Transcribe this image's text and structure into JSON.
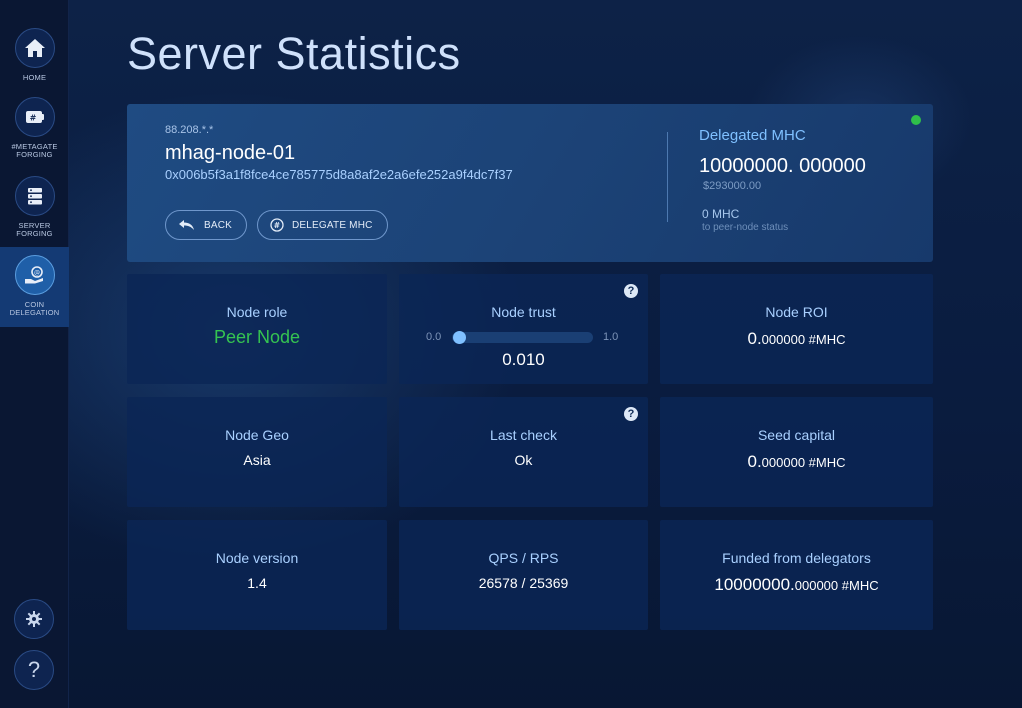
{
  "sidebar": {
    "items": [
      {
        "label": "HOME",
        "icon": "home-icon",
        "active": false
      },
      {
        "label": "#METAGATE FORGING",
        "icon": "wallet-icon",
        "active": false
      },
      {
        "label": "SERVER FORGING",
        "icon": "server-icon",
        "active": false
      },
      {
        "label": "COIN DELEGATION",
        "icon": "coin-hand-icon",
        "active": true
      }
    ],
    "settings_icon": "gear-icon",
    "help_label": "?"
  },
  "page": {
    "title": "Server Statistics"
  },
  "server": {
    "ip": "88.208.*.*",
    "name": "mhag-node-01",
    "address": "0x006b5f3a1f8fce4ce785775d8a8af2e2a6efe252a9f4dc7f37",
    "back_label": "BACK",
    "delegate_label": "DELEGATE MHC",
    "delegated_title": "Delegated MHC",
    "delegated_value": "10000000. 000000",
    "delegated_usd": "$293000.00",
    "peer_mhc": "0 MHC",
    "peer_note": "to peer-node status",
    "status_color": "#2fbf4a"
  },
  "cards": {
    "node_role": {
      "title": "Node role",
      "value": "Peer Node"
    },
    "node_trust": {
      "title": "Node trust",
      "min": "0.0",
      "max": "1.0",
      "value": "0.010",
      "level": 0.01
    },
    "node_roi": {
      "title": "Node ROI",
      "int": "0.",
      "dec": "000000",
      "unit": " #MHC"
    },
    "node_geo": {
      "title": "Node Geo",
      "value": "Asia"
    },
    "last_check": {
      "title": "Last check",
      "value": "Ok"
    },
    "seed_capital": {
      "title": "Seed capital",
      "int": "0.",
      "dec": "000000",
      "unit": " #MHC"
    },
    "node_version": {
      "title": "Node version",
      "value": "1.4"
    },
    "qps_rps": {
      "title": "QPS / RPS",
      "value": "26578 / 25369"
    },
    "funded": {
      "title": "Funded from delegators",
      "int": "10000000.",
      "dec": "000000",
      "unit": " #MHC"
    }
  },
  "help_icon_label": "?"
}
